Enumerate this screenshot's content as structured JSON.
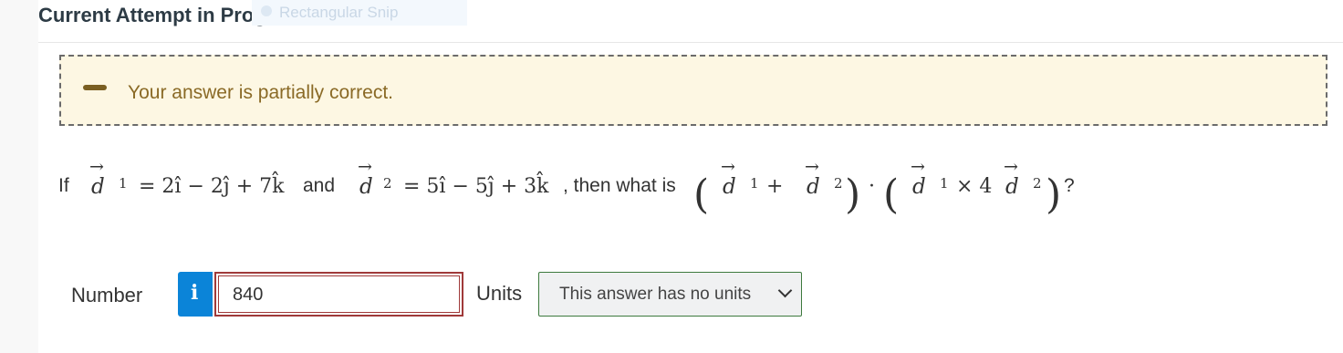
{
  "header": {
    "title": "Current Attempt in Progress",
    "snip_label": "Rectangular Snip"
  },
  "feedback": {
    "message": "Your answer is partially correct."
  },
  "question": {
    "if": "If",
    "d": "d",
    "sub1": "1",
    "sub2": "2",
    "eq1": "= 2î − 2ĵ + 7k̂",
    "and": "and",
    "eq2": "= 5î − 5ĵ + 3k̂",
    "then": ", then what is",
    "plus": "+",
    "dot": "·",
    "cross": "× 4",
    "end": "?"
  },
  "answer": {
    "number_label": "Number",
    "info_icon_glyph": "i",
    "value": "840",
    "units_label": "Units",
    "units_selected": "This answer has no units"
  }
}
